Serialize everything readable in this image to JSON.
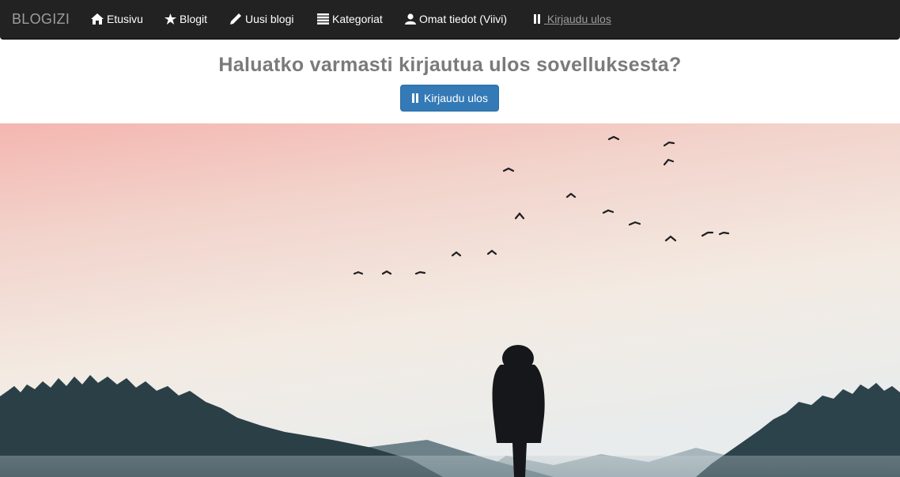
{
  "nav": {
    "brand": "BLOGIZI",
    "items": [
      {
        "label": "Etusivu",
        "icon": "home-icon"
      },
      {
        "label": "Blogit",
        "icon": "star-icon"
      },
      {
        "label": "Uusi blogi",
        "icon": "pencil-icon"
      },
      {
        "label": "Kategoriat",
        "icon": "list-icon"
      },
      {
        "label": "Omat tiedot (Viivi)",
        "icon": "user-icon"
      },
      {
        "label": " Kirjaudu ulos",
        "icon": "pause-icon"
      }
    ]
  },
  "main": {
    "title": "Haluatko varmasti kirjautua ulos sovelluksesta?",
    "logout_button": "Kirjaudu ulos"
  },
  "colors": {
    "navbar": "#222222",
    "brand": "#9d9d9d",
    "button": "#337ab7",
    "title": "#7a7a7a"
  }
}
